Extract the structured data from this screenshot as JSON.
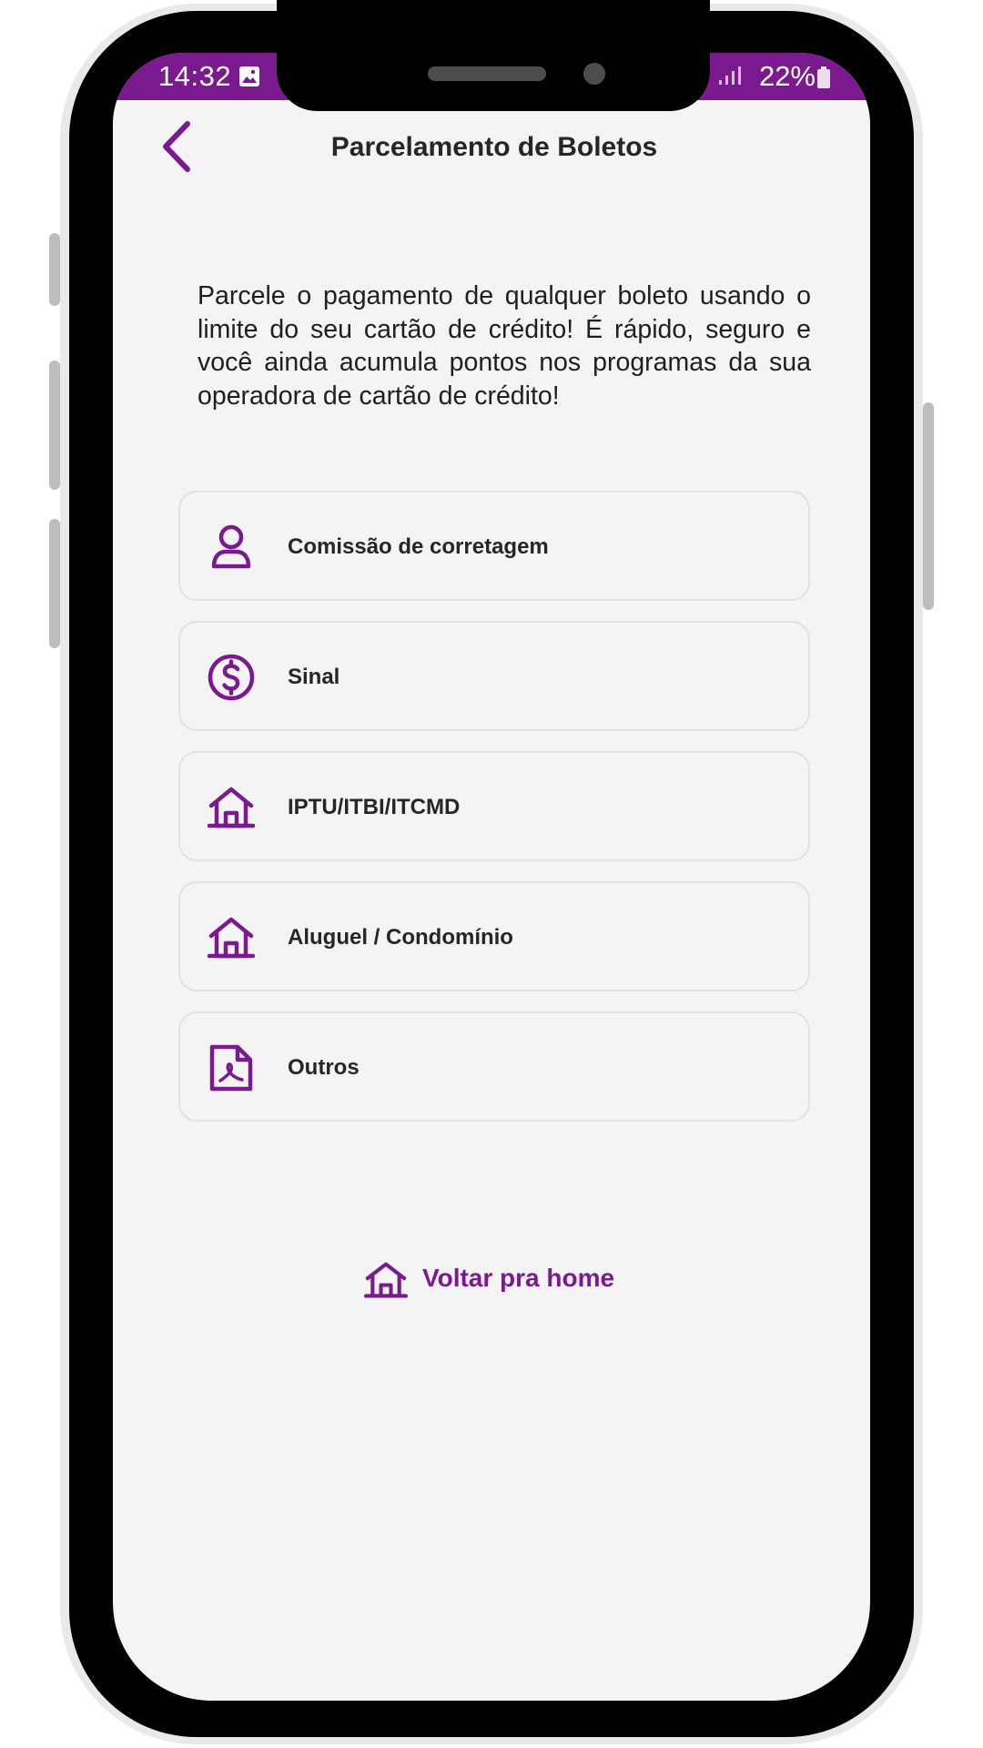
{
  "colors": {
    "accent": "#7b1a8e",
    "text": "#262626",
    "background": "#f4f4f4",
    "card_border": "#e2e2e2"
  },
  "status_bar": {
    "time": "14:32",
    "battery": "22%",
    "left_icon": "image-icon",
    "right_icons": [
      "signal-icon",
      "battery-icon"
    ]
  },
  "header": {
    "title": "Parcelamento de Boletos",
    "back_icon": "chevron-left-icon"
  },
  "intro": {
    "text": "Parcele o pagamento de qualquer boleto usando o limite do seu cartão de crédito! É rápido, seguro e você ainda acumula pontos nos programas da sua operadora de cartão de crédito!"
  },
  "options": [
    {
      "label": "Comissão de corretagem",
      "icon": "user-icon"
    },
    {
      "label": "Sinal",
      "icon": "dollar-circle-icon"
    },
    {
      "label": "IPTU/ITBI/ITCMD",
      "icon": "home-icon"
    },
    {
      "label": "Aluguel / Condomínio",
      "icon": "home-icon"
    },
    {
      "label": "Outros",
      "icon": "document-icon"
    }
  ],
  "home_link": {
    "label": "Voltar pra home",
    "icon": "home-icon"
  }
}
